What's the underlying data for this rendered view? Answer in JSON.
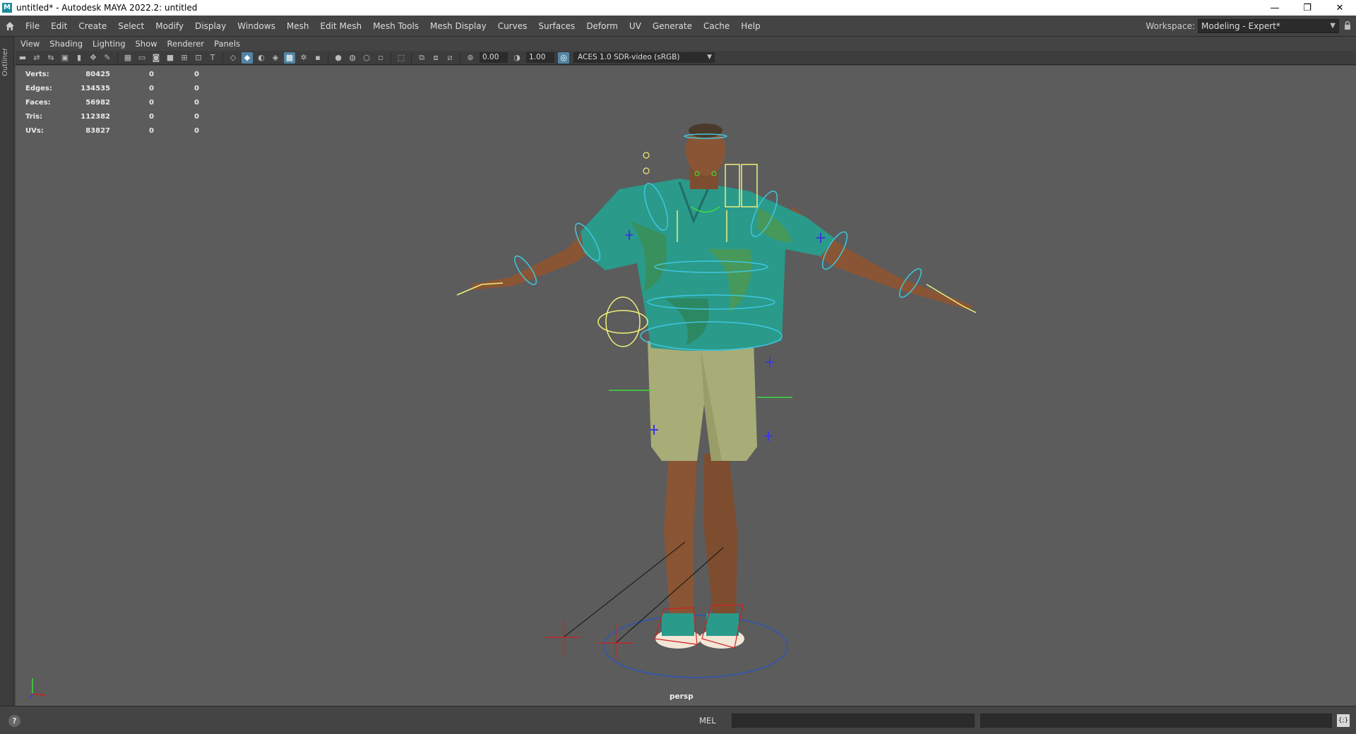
{
  "window": {
    "title": "untitled* - Autodesk MAYA 2022.2: untitled",
    "app_icon": "M",
    "controls": [
      "minimize-icon",
      "restore-icon",
      "close-icon"
    ],
    "control_glyphs": {
      "minimize": "—",
      "restore": "❐",
      "close": "✕"
    }
  },
  "main_menu": {
    "items": [
      "File",
      "Edit",
      "Create",
      "Select",
      "Modify",
      "Display",
      "Windows",
      "Mesh",
      "Edit Mesh",
      "Mesh Tools",
      "Mesh Display",
      "Curves",
      "Surfaces",
      "Deform",
      "UV",
      "Generate",
      "Cache",
      "Help"
    ]
  },
  "workspace": {
    "label": "Workspace:",
    "value": "Modeling - Expert*"
  },
  "left_strip": {
    "outliner_label": "Outliner"
  },
  "panel_menu": {
    "items": [
      "View",
      "Shading",
      "Lighting",
      "Show",
      "Renderer",
      "Panels"
    ]
  },
  "panel_toolbar": {
    "exposure": "0.00",
    "gamma": "1.00",
    "color_space": "ACES 1.0 SDR-video (sRGB)"
  },
  "hud": {
    "rows": [
      {
        "label": "Verts:",
        "v1": "80425",
        "v2": "0",
        "v3": "0"
      },
      {
        "label": "Edges:",
        "v1": "134535",
        "v2": "0",
        "v3": "0"
      },
      {
        "label": "Faces:",
        "v1": "56982",
        "v2": "0",
        "v3": "0"
      },
      {
        "label": "Tris:",
        "v1": "112382",
        "v2": "0",
        "v3": "0"
      },
      {
        "label": "UVs:",
        "v1": "83827",
        "v2": "0",
        "v3": "0"
      }
    ]
  },
  "viewport": {
    "camera": "persp",
    "background": "#5c5c5c"
  },
  "command_line": {
    "help": "?",
    "language": "MEL",
    "input": "",
    "result": ""
  },
  "colors": {
    "rig_control": "#3fc7e0",
    "rig_selected": "#f0f07a",
    "rig_green": "#3ddc3d",
    "ik_locator": "#d02020",
    "pole_plus": "#3a3ad8",
    "shirt": "#2a9a8a",
    "shorts": "#a8ad78",
    "skin": "#8a5534"
  }
}
